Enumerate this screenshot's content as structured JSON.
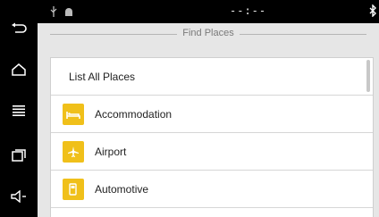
{
  "status_bar": {
    "clock": "--:--"
  },
  "header": {
    "title": "Find Places"
  },
  "places": [
    {
      "label": "List All Places"
    },
    {
      "label": "Accommodation",
      "icon": "bed-icon"
    },
    {
      "label": "Airport",
      "icon": "airplane-icon"
    },
    {
      "label": "Automotive",
      "icon": "fuel-pump-icon"
    }
  ],
  "colors": {
    "icon_bg": "#f0c01a",
    "app_bg": "#e6e6e6"
  }
}
